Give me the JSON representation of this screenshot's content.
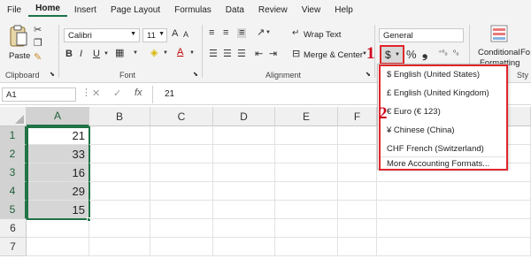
{
  "menu": [
    "File",
    "Home",
    "Insert",
    "Page Layout",
    "Formulas",
    "Data",
    "Review",
    "View",
    "Help"
  ],
  "clipboard": {
    "paste": "Paste",
    "group": "Clipboard"
  },
  "font": {
    "name": "Calibri",
    "size": "11",
    "group": "Font",
    "bold": "B",
    "italic": "I",
    "underline": "U",
    "grow": "A",
    "shrink": "A"
  },
  "alignment": {
    "wrap": "Wrap Text",
    "merge": "Merge & Center",
    "group": "Alignment"
  },
  "number": {
    "format": "General",
    "currency_symbol": "$",
    "percent": "%",
    "comma": "❟",
    "dec_inc": "⁺⁰₀",
    "dec_dec": "⁰₀"
  },
  "styles": {
    "conditional": "Conditional",
    "formatting": "Formatting",
    "format_as": "Fo",
    "sty": "Sty"
  },
  "callouts": {
    "one": "1",
    "two": "2"
  },
  "namebox": "A1",
  "formula_value": "21",
  "fx": "fx",
  "columns": [
    "A",
    "B",
    "C",
    "D",
    "E",
    "F"
  ],
  "rows": [
    "1",
    "2",
    "3",
    "4",
    "5",
    "6",
    "7"
  ],
  "cells_a": [
    "21",
    "33",
    "16",
    "29",
    "15",
    "",
    ""
  ],
  "dropdown_items": [
    "$ English (United States)",
    "£ English (United Kingdom)",
    "€ Euro (€ 123)",
    "¥ Chinese (China)",
    "CHF French (Switzerland)"
  ],
  "dropdown_more": "More Accounting Formats...",
  "colors": {
    "accent_green": "#217346",
    "callout_red": "#e0262b"
  }
}
